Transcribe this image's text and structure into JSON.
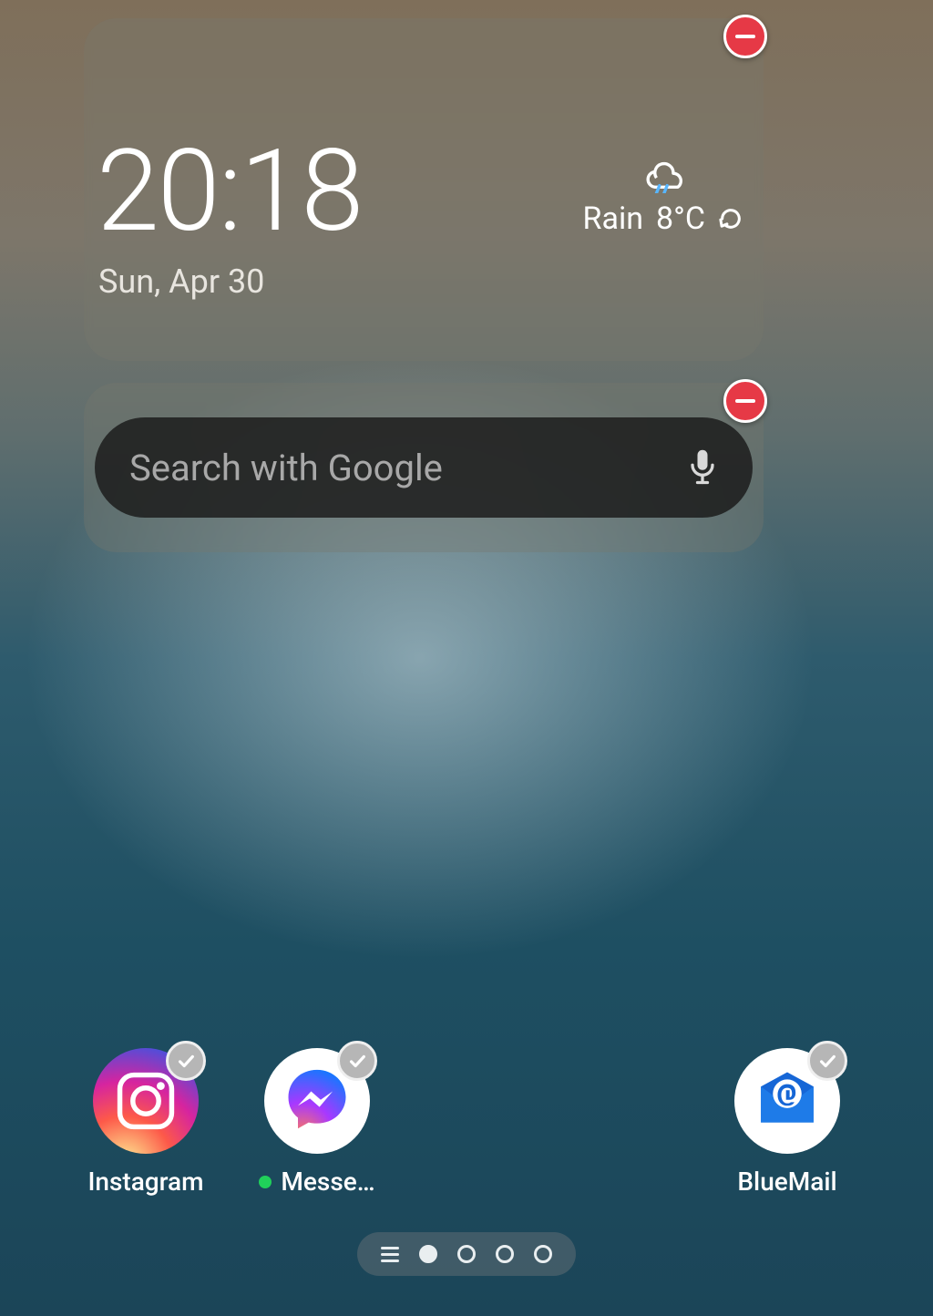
{
  "clock_widget": {
    "time": "20:18",
    "date": "Sun, Apr 30",
    "weather_condition": "Rain",
    "weather_temp": "8°C"
  },
  "search_widget": {
    "placeholder": "Search with Google"
  },
  "apps": {
    "instagram": {
      "label": "Instagram"
    },
    "messenger": {
      "label": "Messe…"
    },
    "bluemail": {
      "label": "BlueMail"
    }
  },
  "pager": {
    "pages": 4,
    "current": 1
  }
}
